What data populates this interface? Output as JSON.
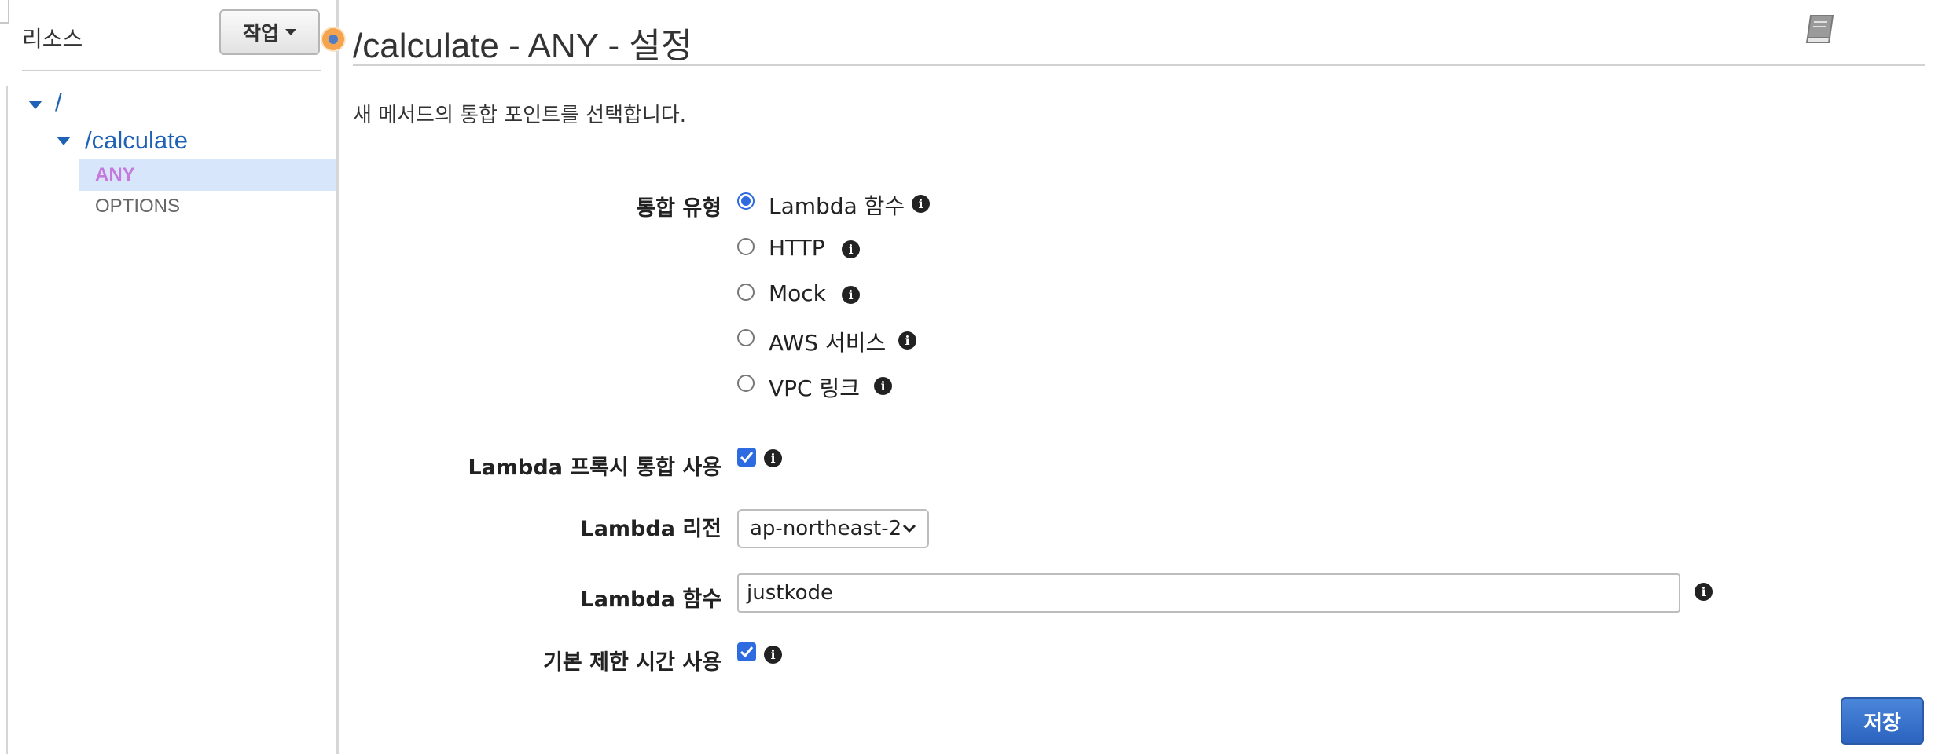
{
  "sidebar": {
    "title": "리소스",
    "actions_label": "작업",
    "tree": {
      "root": "/",
      "child": "/calculate",
      "methods": [
        "ANY",
        "OPTIONS"
      ]
    }
  },
  "header": {
    "title": "/calculate - ANY - 설정"
  },
  "form": {
    "description": "새 메서드의 통합 포인트를 선택합니다.",
    "integration_type_label": "통합 유형",
    "integration_options": [
      "Lambda 함수",
      "HTTP",
      "Mock",
      "AWS 서비스",
      "VPC 링크"
    ],
    "selected_integration": "Lambda 함수",
    "proxy_label": "Lambda 프록시 통합 사용",
    "proxy_checked": true,
    "region_label": "Lambda 리전",
    "region_value": "ap-northeast-2",
    "function_label": "Lambda 함수",
    "function_value": "justkode",
    "timeout_label": "기본 제한 시간 사용",
    "timeout_checked": true,
    "save_label": "저장"
  },
  "colors": {
    "accent": "#2e6be0",
    "link": "#1f62b5",
    "selected_method": "#c479db",
    "selected_row_bg": "#d7e6fb"
  }
}
